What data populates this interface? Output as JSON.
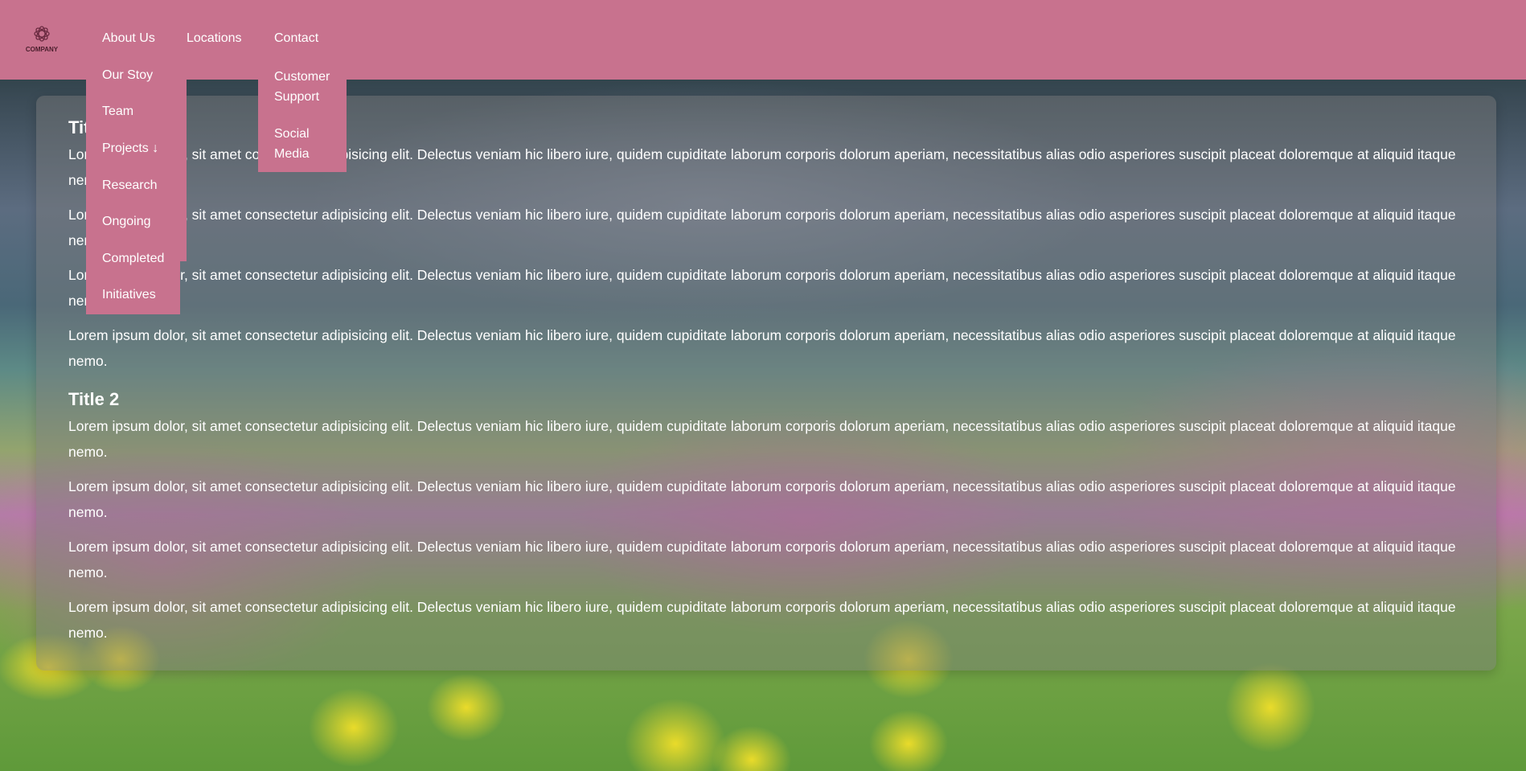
{
  "brand": {
    "logo_text": "COMPANY"
  },
  "nav": {
    "items": [
      {
        "label": "About Us"
      },
      {
        "label": "Locations"
      },
      {
        "label": "Contact"
      }
    ],
    "about_dropdown": [
      "Our Stoy",
      "Team",
      "Projects ↓"
    ],
    "projects_dropdown": [
      "Research",
      "Ongoing",
      "Completed",
      "Initiatives"
    ],
    "contact_dropdown": [
      {
        "line1": "Customer",
        "line2": "Support"
      },
      {
        "line1": "Social",
        "line2": "Media"
      }
    ]
  },
  "content": {
    "sections": [
      {
        "title": "Title 1",
        "paragraphs": [
          "Lorem ipsum dolor, sit amet consectetur adipisicing elit. Delectus veniam hic libero iure, quidem cupiditate laborum corporis dolorum aperiam, necessitatibus alias odio asperiores suscipit placeat doloremque at aliquid itaque nemo.",
          "Lorem ipsum dolor, sit amet consectetur adipisicing elit. Delectus veniam hic libero iure, quidem cupiditate laborum corporis dolorum aperiam, necessitatibus alias odio asperiores suscipit placeat doloremque at aliquid itaque nemo.",
          "Lorem ipsum dolor, sit amet consectetur adipisicing elit. Delectus veniam hic libero iure, quidem cupiditate laborum corporis dolorum aperiam, necessitatibus alias odio asperiores suscipit placeat doloremque at aliquid itaque nemo.",
          "Lorem ipsum dolor, sit amet consectetur adipisicing elit. Delectus veniam hic libero iure, quidem cupiditate laborum corporis dolorum aperiam, necessitatibus alias odio asperiores suscipit placeat doloremque at aliquid itaque nemo."
        ]
      },
      {
        "title": "Title 2",
        "paragraphs": [
          "Lorem ipsum dolor, sit amet consectetur adipisicing elit. Delectus veniam hic libero iure, quidem cupiditate laborum corporis dolorum aperiam, necessitatibus alias odio asperiores suscipit placeat doloremque at aliquid itaque nemo.",
          "Lorem ipsum dolor, sit amet consectetur adipisicing elit. Delectus veniam hic libero iure, quidem cupiditate laborum corporis dolorum aperiam, necessitatibus alias odio asperiores suscipit placeat doloremque at aliquid itaque nemo.",
          "Lorem ipsum dolor, sit amet consectetur adipisicing elit. Delectus veniam hic libero iure, quidem cupiditate laborum corporis dolorum aperiam, necessitatibus alias odio asperiores suscipit placeat doloremque at aliquid itaque nemo.",
          "Lorem ipsum dolor, sit amet consectetur adipisicing elit. Delectus veniam hic libero iure, quidem cupiditate laborum corporis dolorum aperiam, necessitatibus alias odio asperiores suscipit placeat doloremque at aliquid itaque nemo."
        ]
      }
    ]
  },
  "colors": {
    "navbar": "#c8728e",
    "text": "#ffffff",
    "card": "rgba(125,125,125,0.45)"
  }
}
